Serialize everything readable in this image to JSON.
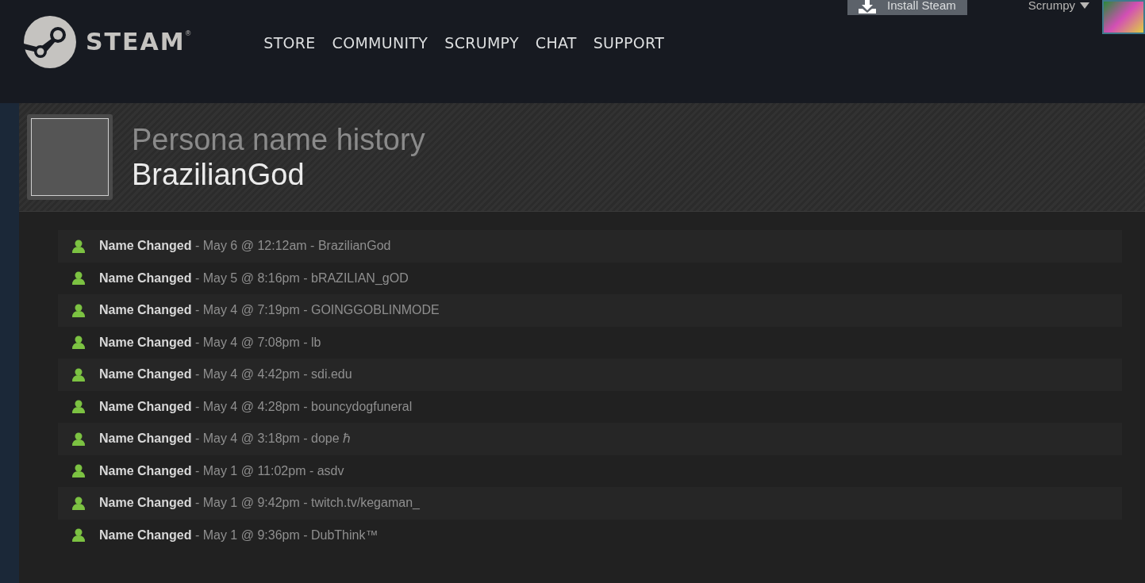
{
  "header": {
    "logo_text": "STEAM",
    "logo_mark": "®",
    "nav": [
      {
        "label": "STORE"
      },
      {
        "label": "COMMUNITY"
      },
      {
        "label": "SCRUMPY"
      },
      {
        "label": "CHAT"
      },
      {
        "label": "SUPPORT"
      }
    ],
    "install_button": "Install Steam",
    "account": "Scrumpy"
  },
  "profile": {
    "title": "Persona name history",
    "name": "BrazilianGod"
  },
  "history": [
    {
      "text": "**Name Changed** - May 6 @ 12:12am - BrazilianGod"
    },
    {
      "text": "**Name Changed** - May 5 @ 8:16pm - bRAZILIAN_gOD"
    },
    {
      "text": "**Name Changed** - May 4 @ 7:19pm - GOINGGOBLINMODE"
    },
    {
      "text": "**Name Changed** - May 4 @ 7:08pm - lb"
    },
    {
      "text": "**Name Changed** - May 4 @ 4:42pm - sdi.edu"
    },
    {
      "text": "**Name Changed** - May 4 @ 4:28pm - bouncydogfuneral"
    },
    {
      "text": "**Name Changed** - May 4 @ 3:18pm - dope ℏ"
    },
    {
      "text": "**Name Changed** - May 1 @ 11:02pm - asdv"
    },
    {
      "text": "**Name Changed** - May 1 @ 9:42pm - twitch.tv/kegaman_"
    },
    {
      "text": "**Name Changed** - May 1 @ 9:36pm - DubThink™"
    }
  ]
}
